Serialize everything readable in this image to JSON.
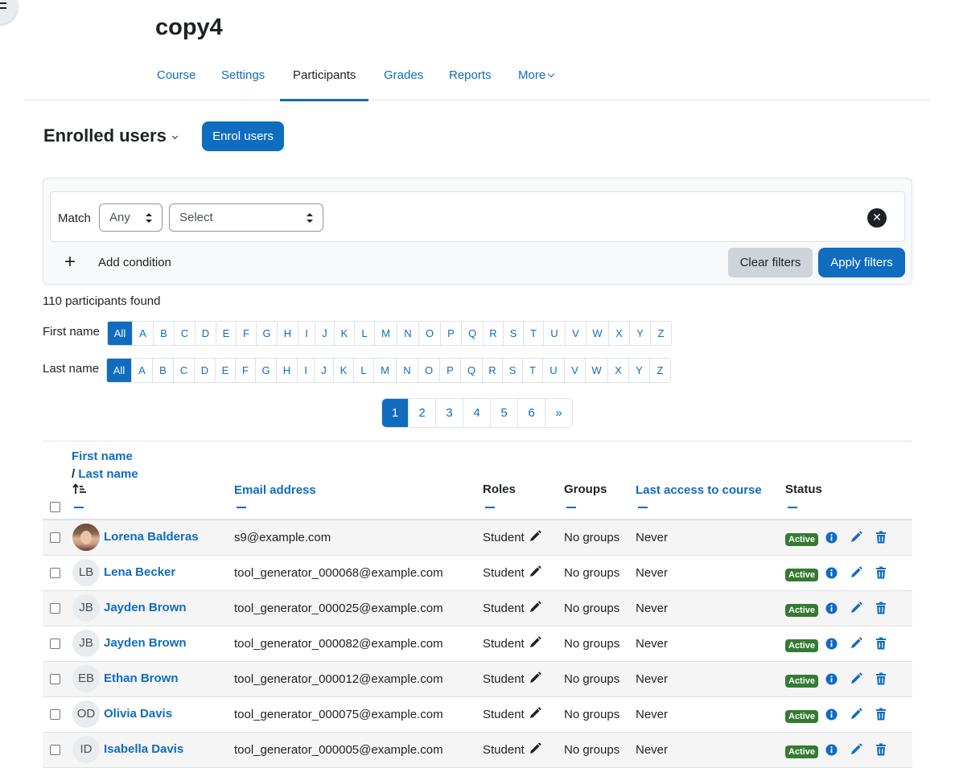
{
  "page": {
    "course_title": "copy4"
  },
  "secondary_nav": {
    "tabs": [
      {
        "label": "Course"
      },
      {
        "label": "Settings"
      },
      {
        "label": "Participants"
      },
      {
        "label": "Grades"
      },
      {
        "label": "Reports"
      },
      {
        "label": "More"
      }
    ],
    "active_tab": "Participants"
  },
  "header": {
    "heading": "Enrolled users",
    "enrol_button": "Enrol users"
  },
  "filters": {
    "match_label": "Match",
    "match_value": "Any",
    "type_value": "Select",
    "add_condition": "Add condition",
    "clear_button": "Clear filters",
    "apply_button": "Apply filters"
  },
  "participants_found": "110 participants found",
  "initials": {
    "first_label": "First name",
    "last_label": "Last name",
    "letters": [
      "All",
      "A",
      "B",
      "C",
      "D",
      "E",
      "F",
      "G",
      "H",
      "I",
      "J",
      "K",
      "L",
      "M",
      "N",
      "O",
      "P",
      "Q",
      "R",
      "S",
      "T",
      "U",
      "V",
      "W",
      "X",
      "Y",
      "Z"
    ],
    "active": "All"
  },
  "pagination": {
    "pages": [
      "1",
      "2",
      "3",
      "4",
      "5",
      "6",
      "»"
    ],
    "current": "1"
  },
  "table": {
    "headers": {
      "first_name": "First name",
      "separator": "/",
      "last_name": "Last name",
      "email": "Email address",
      "roles": "Roles",
      "groups": "Groups",
      "last_access": "Last access to course",
      "status": "Status"
    },
    "rows": [
      {
        "initials": "",
        "name": "Lorena Balderas",
        "email": "s9@example.com",
        "role": "Student",
        "groups": "No groups",
        "last_access": "Never",
        "status": "Active"
      },
      {
        "initials": "LB",
        "name": "Lena Becker",
        "email": "tool_generator_000068@example.com",
        "role": "Student",
        "groups": "No groups",
        "last_access": "Never",
        "status": "Active"
      },
      {
        "initials": "JB",
        "name": "Jayden Brown",
        "email": "tool_generator_000025@example.com",
        "role": "Student",
        "groups": "No groups",
        "last_access": "Never",
        "status": "Active"
      },
      {
        "initials": "JB",
        "name": "Jayden Brown",
        "email": "tool_generator_000082@example.com",
        "role": "Student",
        "groups": "No groups",
        "last_access": "Never",
        "status": "Active"
      },
      {
        "initials": "EB",
        "name": "Ethan Brown",
        "email": "tool_generator_000012@example.com",
        "role": "Student",
        "groups": "No groups",
        "last_access": "Never",
        "status": "Active"
      },
      {
        "initials": "OD",
        "name": "Olivia Davis",
        "email": "tool_generator_000075@example.com",
        "role": "Student",
        "groups": "No groups",
        "last_access": "Never",
        "status": "Active"
      },
      {
        "initials": "ID",
        "name": "Isabella Davis",
        "email": "tool_generator_000005@example.com",
        "role": "Student",
        "groups": "No groups",
        "last_access": "Never",
        "status": "Active"
      }
    ]
  },
  "colors": {
    "primary": "#0f6cbf",
    "success": "#357a32",
    "text": "#1d2125",
    "border": "#dee2e6"
  }
}
